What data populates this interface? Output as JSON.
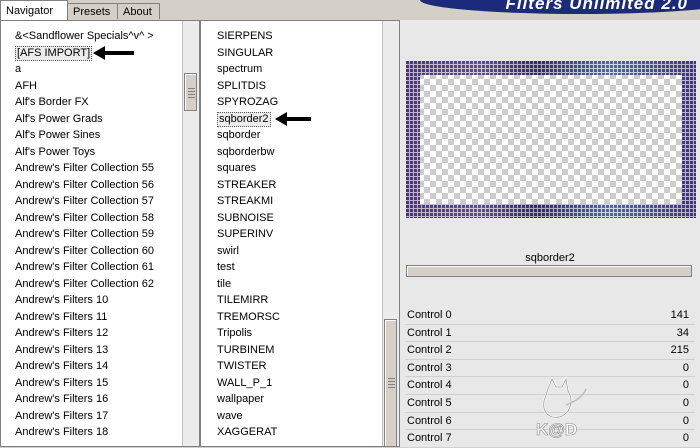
{
  "tabs": [
    "Navigator",
    "Presets",
    "About"
  ],
  "banner_title": "Filters Unlimited 2.0",
  "left_list": [
    "&<Sandflower Specials^v^ >",
    "[AFS IMPORT]",
    "a",
    "AFH",
    "Alf's Border FX",
    "Alf's Power Grads",
    "Alf's Power Sines",
    "Alf's Power Toys",
    "Andrew's Filter Collection 55",
    "Andrew's Filter Collection 56",
    "Andrew's Filter Collection 57",
    "Andrew's Filter Collection 58",
    "Andrew's Filter Collection 59",
    "Andrew's Filter Collection 60",
    "Andrew's Filter Collection 61",
    "Andrew's Filter Collection 62",
    "Andrew's Filters 10",
    "Andrew's Filters 11",
    "Andrew's Filters 12",
    "Andrew's Filters 13",
    "Andrew's Filters 14",
    "Andrew's Filters 15",
    "Andrew's Filters 16",
    "Andrew's Filters 17",
    "Andrew's Filters 18"
  ],
  "left_selected": "[AFS IMPORT]",
  "mid_list": [
    "SIERPENS",
    "SINGULAR",
    "spectrum",
    "SPLITDIS",
    "SPYROZAG",
    "sqborder2",
    "sqborder",
    "sqborderbw",
    "squares",
    "STREAKER",
    "STREAKMI",
    "SUBNOISE",
    "SUPERINV",
    "swirl",
    "test",
    "tile",
    "TILEMIRR",
    "TREMORSC",
    "Tripolis",
    "TURBINEM",
    "TWISTER",
    "WALL_P_1",
    "wallpaper",
    "wave",
    "XAGGERAT"
  ],
  "mid_selected": "sqborder2",
  "filter_name": "sqborder2",
  "controls": [
    {
      "label": "Control 0",
      "value": "141"
    },
    {
      "label": "Control 1",
      "value": "34"
    },
    {
      "label": "Control 2",
      "value": "215"
    },
    {
      "label": "Control 3",
      "value": "0"
    },
    {
      "label": "Control 4",
      "value": "0"
    },
    {
      "label": "Control 5",
      "value": "0"
    },
    {
      "label": "Control 6",
      "value": "0"
    },
    {
      "label": "Control 7",
      "value": "0"
    }
  ],
  "logo_text": "K@D",
  "colors": {
    "banner": "#1b2a7a",
    "border_purple": "#6a4f8e",
    "border_blue": "#8fb6e6",
    "border_dark": "#2a2250"
  }
}
